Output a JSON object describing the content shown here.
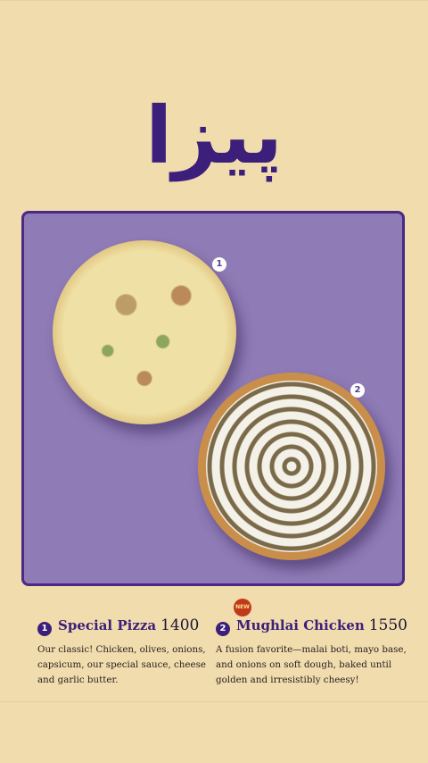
{
  "menu": {
    "title": "پیزا"
  },
  "markers": {
    "first": "1",
    "second": "2"
  },
  "items": [
    {
      "number": "1",
      "name": "Special Pizza",
      "price": "1400",
      "description": "Our classic! Chicken, olives, onions, capsicum, our special sauce, cheese and garlic butter."
    },
    {
      "number": "2",
      "name": "Mughlai Chicken",
      "price": "1550",
      "badge": "NEW",
      "description": "A fusion favorite—malai boti, mayo base, and onions on soft dough, baked until golden and irresistibly cheesy!"
    }
  ],
  "colors": {
    "background": "#f1dcae",
    "accent": "#3b1f7a",
    "panel": "#8f7bb6",
    "badge": "#c0391b"
  }
}
